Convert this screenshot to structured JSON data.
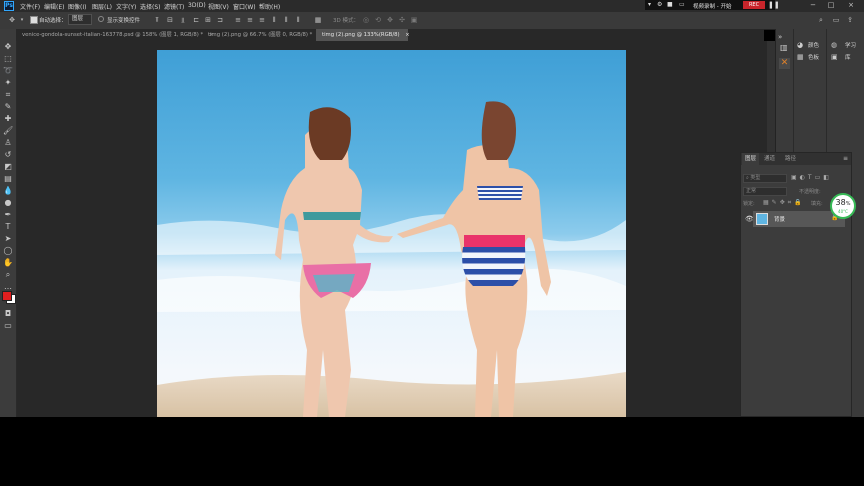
{
  "menu": {
    "items": [
      "文件(F)",
      "编辑(E)",
      "图像(I)",
      "图层(L)",
      "文字(Y)",
      "选择(S)",
      "滤镜(T)",
      "3D(D)",
      "视图(V)",
      "窗口(W)",
      "帮助(H)"
    ]
  },
  "recorder": {
    "title": "视频录制 - 开始",
    "badge": "REC"
  },
  "options_bar": {
    "auto_select_label": "自动选择：",
    "auto_select_value": "图层",
    "show_transform_label": "显示变换控件",
    "mode_3d_label": "3D 模式："
  },
  "tabs": [
    {
      "label": "venice-gondola-sunset-italian-163778.psd @ 158% (图层 1, RGB/8) *",
      "close": "×"
    },
    {
      "label": "timg (2).png @ 66.7% (图层 0, RGB/8) *",
      "close": "×"
    },
    {
      "label": "timg (2).png @ 133%(RGB/8)",
      "close": "×"
    }
  ],
  "right_panels": {
    "color_label": "颜色",
    "swatches_label": "色板",
    "learn_label": "学习",
    "library_label": "库"
  },
  "layers_panel": {
    "tabs": [
      "图层",
      "通道",
      "路径"
    ],
    "kind_filter": "类型",
    "blend_mode": "正常",
    "opacity_label": "不透明度:",
    "lock_label": "锁定:",
    "fill_label": "填充:",
    "layer_name": "背景"
  },
  "cpu_monitor": {
    "percent": "38",
    "unit": "%",
    "temp": "40°C"
  },
  "colors": {
    "foreground": "#e01f1f",
    "background": "#ffffff",
    "accent": "#31a8ff"
  }
}
